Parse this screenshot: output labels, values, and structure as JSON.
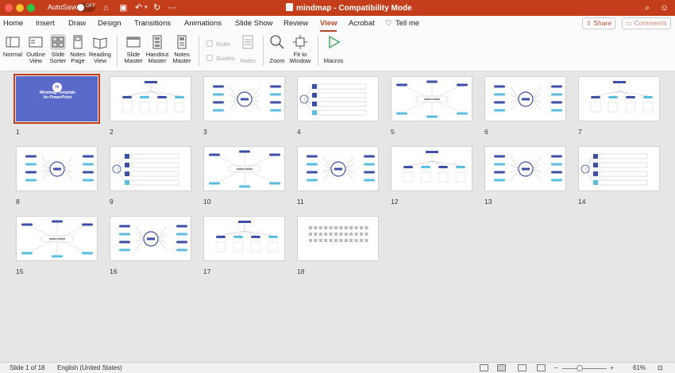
{
  "titlebar": {
    "autosave_label": "AutoSave",
    "autosave_state": "OFF",
    "doc_title": "mindmap  -  Compatibility Mode"
  },
  "tabs": [
    {
      "label": "Home"
    },
    {
      "label": "Insert"
    },
    {
      "label": "Draw"
    },
    {
      "label": "Design"
    },
    {
      "label": "Transitions"
    },
    {
      "label": "Animations"
    },
    {
      "label": "Slide Show"
    },
    {
      "label": "Review"
    },
    {
      "label": "View"
    },
    {
      "label": "Acrobat"
    },
    {
      "label": "Tell me"
    }
  ],
  "active_tab": "View",
  "share_label": "Share",
  "comments_label": "Comments",
  "ribbon": {
    "normal": "Normal",
    "outline_1": "Outline",
    "outline_2": "View",
    "sorter_1": "Slide",
    "sorter_2": "Sorter",
    "notes_1": "Notes",
    "notes_2": "Page",
    "reading_1": "Reading",
    "reading_2": "View",
    "slide_master_1": "Slide",
    "slide_master_2": "Master",
    "handout_1": "Handout",
    "handout_2": "Master",
    "notes_master_1": "Notes",
    "notes_master_2": "Master",
    "ruler": "Ruler",
    "guides": "Guides",
    "notes": "Notes",
    "zoom": "Zoom",
    "fit_1": "Fit to",
    "fit_2": "Window",
    "macros": "Macros"
  },
  "cover": {
    "badge": "Hi",
    "line1": "Mindmap Template",
    "line2": "for PowerPoint"
  },
  "slides": [
    "1",
    "2",
    "3",
    "4",
    "5",
    "6",
    "7",
    "8",
    "9",
    "10",
    "11",
    "12",
    "13",
    "14",
    "15",
    "16",
    "17",
    "18"
  ],
  "selected_slide": "1",
  "status": {
    "slide_info": "Slide 1 of 18",
    "language": "English (United States)",
    "zoom": "61%"
  },
  "colors": {
    "accent": "#c43e1c",
    "cover_bg": "#5a6ac9",
    "diagram_dark": "#3d4fa8",
    "diagram_light": "#5bbde0"
  }
}
